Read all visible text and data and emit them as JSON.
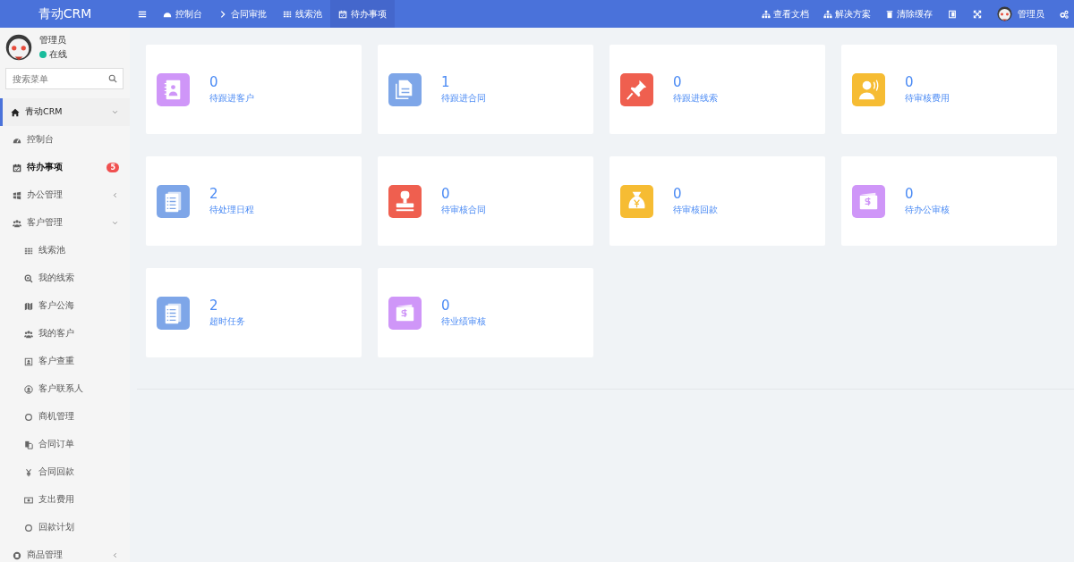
{
  "topbar": {
    "logo": "青动CRM",
    "tabs": [
      {
        "label": "控制台",
        "selected": false
      },
      {
        "label": "合同审批",
        "selected": false
      },
      {
        "label": "线索池",
        "selected": false
      },
      {
        "label": "待办事项",
        "selected": true
      }
    ],
    "links": [
      "查看文档",
      "解决方案",
      "清除缓存"
    ],
    "user": "管理员"
  },
  "sidebar": {
    "user": {
      "name": "管理员",
      "status": "在线"
    },
    "search": {
      "placeholder": "搜索菜单"
    },
    "items": [
      {
        "label": "青动CRM",
        "selected": false,
        "expanded": true,
        "children": [
          {
            "label": "控制台",
            "selected": false
          },
          {
            "label": "待办事项",
            "selected": true,
            "badge": "5"
          },
          {
            "label": "办公管理",
            "selected": false,
            "expanded": false
          },
          {
            "label": "客户管理",
            "selected": false,
            "expanded": true,
            "children": [
              {
                "label": "线索池",
                "selected": false
              },
              {
                "label": "我的线索",
                "selected": false
              },
              {
                "label": "客户公海",
                "selected": false
              },
              {
                "label": "我的客户",
                "selected": false
              },
              {
                "label": "客户查重",
                "selected": false
              },
              {
                "label": "客户联系人",
                "selected": false
              },
              {
                "label": "商机管理",
                "selected": false
              },
              {
                "label": "合同订单",
                "selected": false
              },
              {
                "label": "合同回款",
                "selected": false
              },
              {
                "label": "支出费用",
                "selected": false
              },
              {
                "label": "回款计划",
                "selected": false
              }
            ]
          },
          {
            "label": "商品管理",
            "selected": false,
            "expanded": false
          }
        ]
      }
    ]
  },
  "cards": [
    {
      "value": "0",
      "label": "待跟进客户",
      "color": "#cf96f8",
      "kind": "contacts"
    },
    {
      "value": "1",
      "label": "待跟进合同",
      "color": "#7ea6e8",
      "kind": "document"
    },
    {
      "value": "0",
      "label": "待跟进线索",
      "color": "#ef5f4f",
      "kind": "pin"
    },
    {
      "value": "0",
      "label": "待审核费用",
      "color": "#f6bc33",
      "kind": "support"
    },
    {
      "value": "2",
      "label": "待处理日程",
      "color": "#7ea6e8",
      "kind": "list"
    },
    {
      "value": "0",
      "label": "待审核合同",
      "color": "#ef5f4f",
      "kind": "stamp"
    },
    {
      "value": "0",
      "label": "待审核回款",
      "color": "#f6bc33",
      "kind": "moneybag"
    },
    {
      "value": "0",
      "label": "待办公审核",
      "color": "#cf96f8",
      "kind": "wallet"
    },
    {
      "value": "2",
      "label": "超时任务",
      "color": "#7ea6e8",
      "kind": "list"
    },
    {
      "value": "0",
      "label": "待业绩审核",
      "color": "#cf96f8",
      "kind": "wallet"
    }
  ]
}
